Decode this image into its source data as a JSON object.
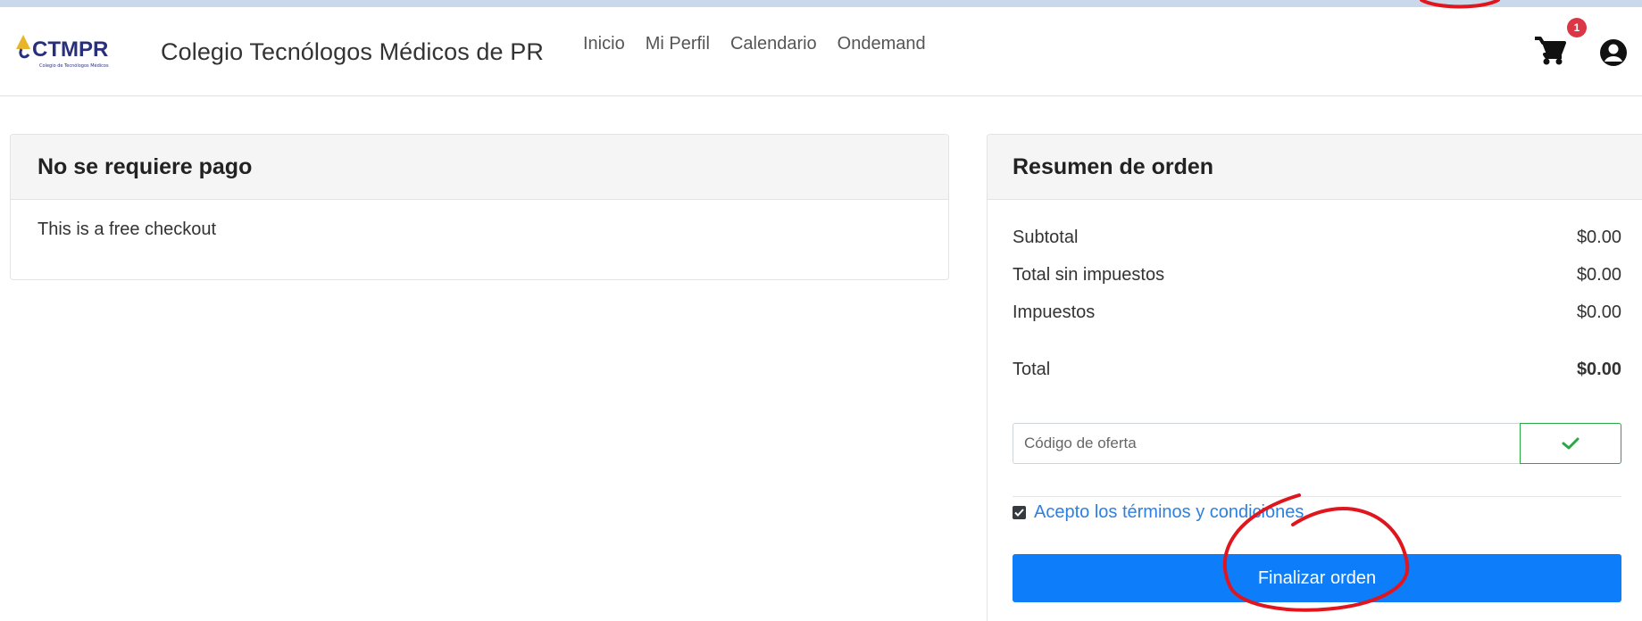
{
  "header": {
    "logo_text": "CTMPR",
    "logo_subtext": "Colegio de Tecnólogos Médicos de Puerto Rico",
    "brand_name": "Colegio Tecnólogos Médicos de PR",
    "nav": [
      "Inicio",
      "Mi Perfil",
      "Calendario",
      "Ondemand"
    ],
    "cart_count": "1",
    "icons": {
      "cart": "cart-icon",
      "user": "user-circle-icon"
    }
  },
  "payment": {
    "title": "No se requiere pago",
    "message": "This is a free checkout"
  },
  "summary": {
    "title": "Resumen de orden",
    "rows": [
      {
        "label": "Subtotal",
        "value": "$0.00"
      },
      {
        "label": "Total sin impuestos",
        "value": "$0.00"
      },
      {
        "label": "Impuestos",
        "value": "$0.00"
      }
    ],
    "total_label": "Total",
    "total_value": "$0.00",
    "promo_placeholder": "Código de oferta",
    "terms_label": "Acepto los términos y condiciones",
    "terms_checked": true,
    "submit_label": "Finalizar orden"
  },
  "colors": {
    "accent": "#0d7dfa",
    "success": "#28a745",
    "badge": "#dc3545",
    "annotation": "#e0161e"
  }
}
